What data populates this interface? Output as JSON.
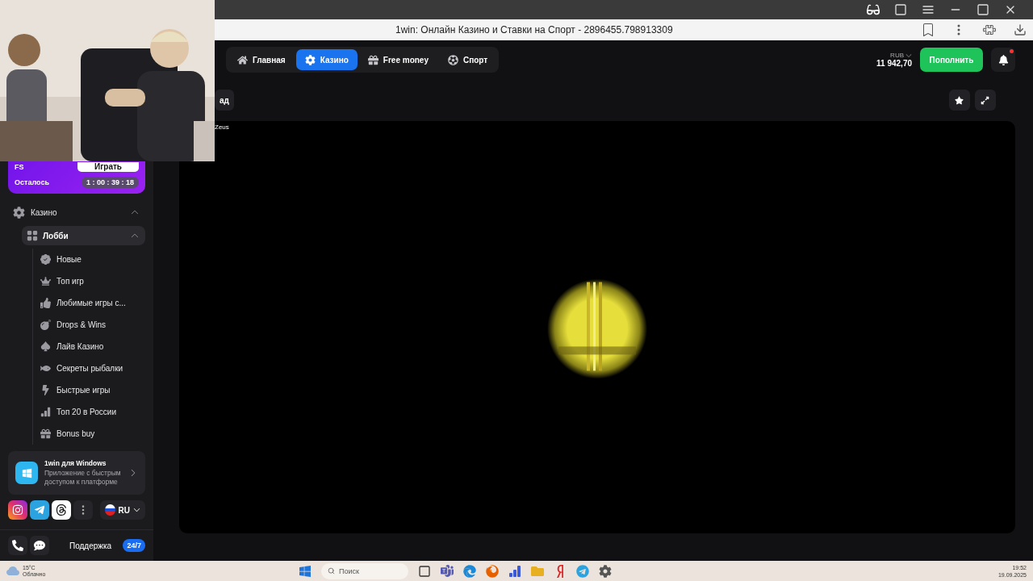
{
  "browser": {
    "tab_title": "1win: Онлайн Казино и Ставки на Спорт - 2896455.798913309"
  },
  "header": {
    "nav": [
      {
        "label": "Главная",
        "selected": false
      },
      {
        "label": "Казино",
        "selected": true
      },
      {
        "label": "Free money",
        "selected": false
      },
      {
        "label": "Спорт",
        "selected": false
      }
    ],
    "currency": "RUB",
    "balance": "11 942,70",
    "deposit": "Пополнить",
    "unread": true
  },
  "toolbar": {
    "back": "ад"
  },
  "game": {
    "title": "Zeus",
    "kind": "picture"
  },
  "sidebar": {
    "promo": {
      "label": "FS",
      "play": "Играть",
      "remaining": "Осталось",
      "timer": "1 : 00 : 39 : 18"
    },
    "menu": [
      {
        "label": "Казино",
        "expanded": true,
        "selected": false,
        "children": [
          {
            "label": "Лобби",
            "expanded": true,
            "selected": true,
            "children": [
              {
                "label": "Новые",
                "selected": false
              },
              {
                "label": "Топ игр",
                "selected": false
              },
              {
                "label": "Любимые игры с...",
                "selected": false
              },
              {
                "label": "Drops & Wins",
                "selected": false
              },
              {
                "label": "Лайв Казино",
                "selected": false
              },
              {
                "label": "Секреты рыбалки",
                "selected": false
              },
              {
                "label": "Быстрые игры",
                "selected": false
              },
              {
                "label": "Топ 20 в России",
                "selected": false
              },
              {
                "label": "Bonus buy",
                "selected": false
              }
            ]
          }
        ]
      }
    ],
    "app_card": {
      "title": "1win для Windows",
      "text": "Приложение с быстрым доступом к платформе"
    },
    "language": "RU",
    "support": {
      "label": "Поддержка",
      "badge": "24/7"
    }
  },
  "taskbar": {
    "temperature": "15°C",
    "weather": "Облачно",
    "search_placeholder": "Поиск",
    "time": "19:52",
    "date": "19.09.2025"
  }
}
